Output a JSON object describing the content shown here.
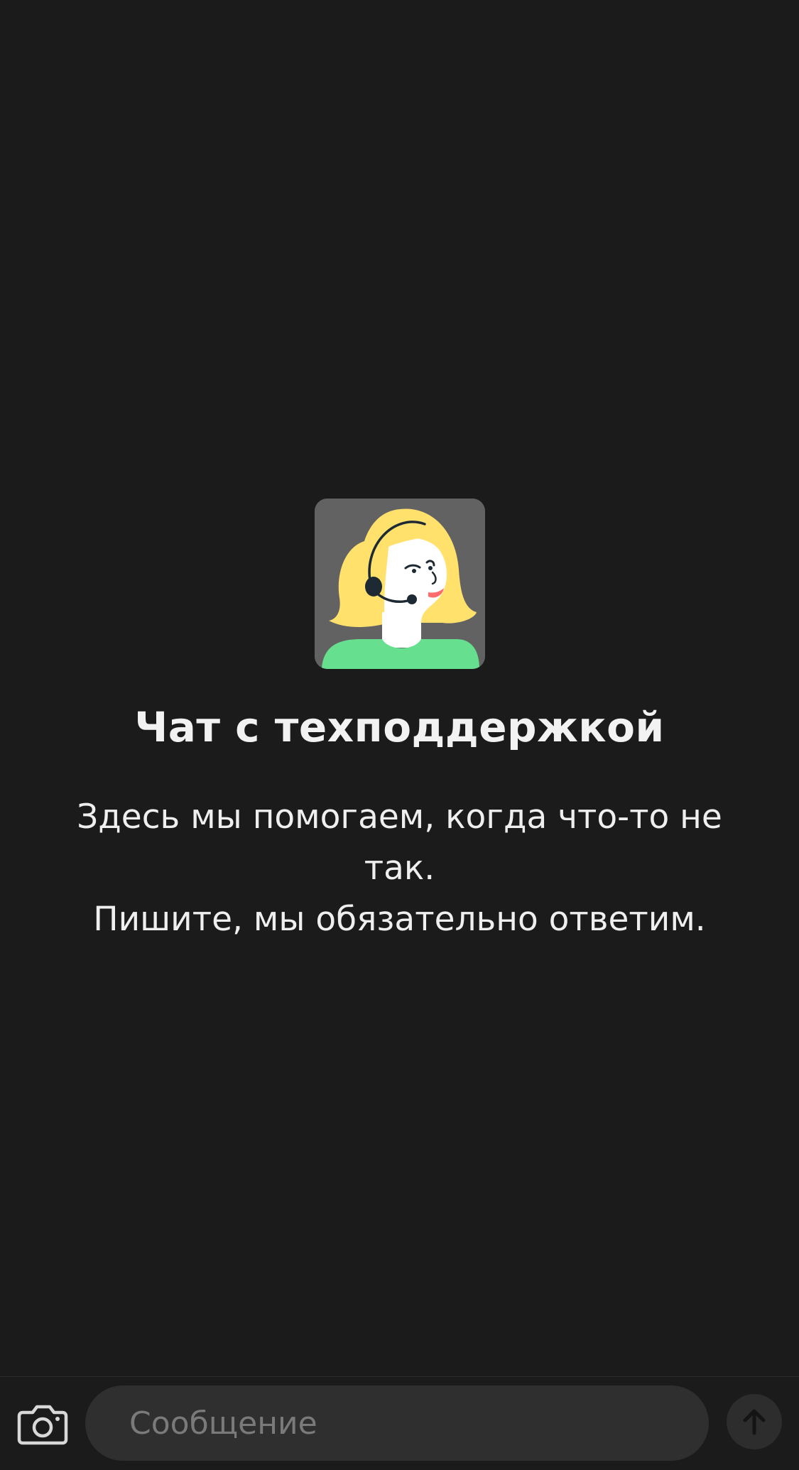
{
  "chat": {
    "title": "Чат с техподдержкой",
    "description_line1": "Здесь мы помогаем, когда что-то не так.",
    "description_line2": "Пишите, мы обязательно ответим.",
    "avatar_icon": "support-agent-avatar"
  },
  "composer": {
    "placeholder": "Сообщение",
    "camera_icon": "camera-icon",
    "send_icon": "arrow-up-icon"
  },
  "colors": {
    "background": "#1b1b1b",
    "avatar_bg": "#626262",
    "hair": "#ffe16b",
    "shirt": "#66e08e",
    "input_bg": "#2f2f2f"
  }
}
